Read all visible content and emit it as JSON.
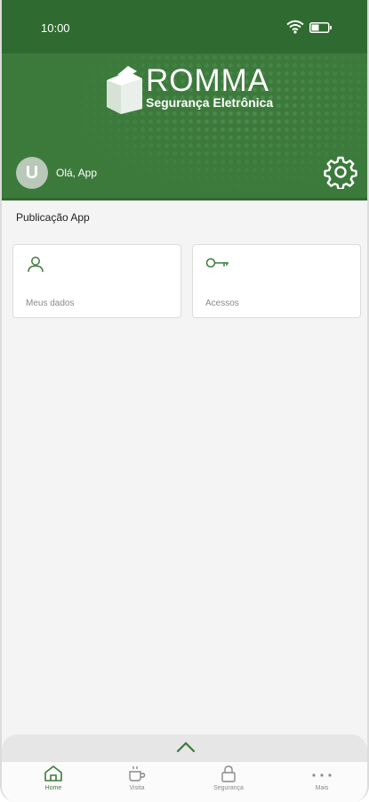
{
  "status_bar": {
    "time": "10:00"
  },
  "header": {
    "brand": "ROMMA",
    "tagline": "Segurança Eletrônica",
    "avatar_initial": "U",
    "greeting": "Olá, App",
    "settings_icon": "gear-icon"
  },
  "main": {
    "section_title": "Publicação App",
    "cards": [
      {
        "label": "Meus dados",
        "icon": "user-icon"
      },
      {
        "label": "Acessos",
        "icon": "key-icon"
      }
    ]
  },
  "tabbar": {
    "items": [
      {
        "label": "Home",
        "icon": "home-icon",
        "active": true
      },
      {
        "label": "Visita",
        "icon": "coffee-cup-icon",
        "active": false
      },
      {
        "label": "Segurança",
        "icon": "lock-icon",
        "active": false
      },
      {
        "label": "Mais",
        "icon": "more-dots-icon",
        "active": false
      }
    ]
  },
  "colors": {
    "brand_green": "#3c7a3c",
    "status_green": "#2f6b30",
    "background": "#f4f4f4"
  }
}
